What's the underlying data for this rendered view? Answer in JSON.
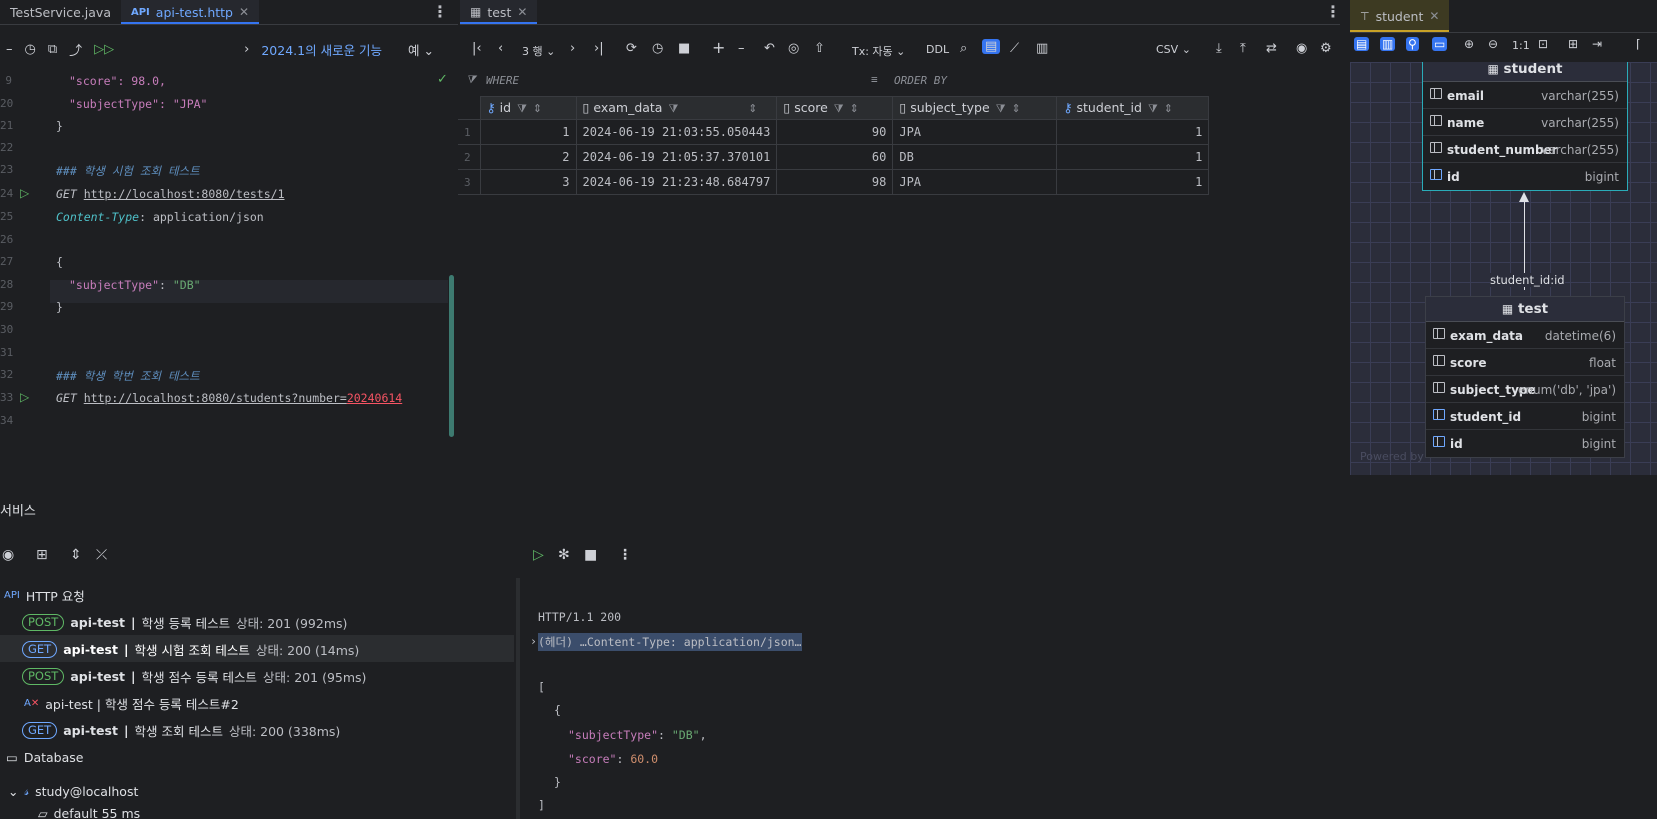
{
  "editor_tabs": [
    {
      "label": "TestService.java",
      "active": false
    },
    {
      "label": "api-test.http",
      "active": true,
      "icon": "API"
    }
  ],
  "grid_tabs": [
    {
      "label": "test",
      "active": true
    }
  ],
  "diagram_tabs": [
    {
      "label": "student",
      "active": true
    }
  ],
  "editor_toolbar": {
    "banner": "2024.1의 새로운 기능",
    "more": "예"
  },
  "editor": {
    "line_numbers": [
      "9",
      "20",
      "21",
      "22",
      "23",
      "24",
      "25",
      "26",
      "27",
      "28",
      "29",
      "30",
      "31",
      "32",
      "33",
      "34"
    ],
    "score_line": "\"score\": 98.0,",
    "subject_line": "\"subjectType\": \"JPA\"",
    "close_brace": "}",
    "comment1": "### 학생 시험 조회 테스트",
    "get1_method": "GET",
    "get1_url": "http://localhost:8080/tests/1",
    "ct_key": "Content-Type",
    "ct_val": ": application/json",
    "open_brace": "{",
    "body_key": "\"subjectType\"",
    "body_val": "\"DB\"",
    "close_brace2": "}",
    "comment2": "### 학생 학번 조회 테스트",
    "get2_method": "GET",
    "get2_url": "http://localhost:8080/students?number=",
    "get2_param": "20240614"
  },
  "grid_toolbar": {
    "rows": "3 행",
    "tx": "Tx: 자동",
    "ddl": "DDL",
    "format": "CSV"
  },
  "filter": {
    "where": "WHERE",
    "order_by": "ORDER BY"
  },
  "table": {
    "columns": [
      "id",
      "exam_data",
      "score",
      "subject_type",
      "student_id"
    ],
    "rows": [
      {
        "rn": "1",
        "id": "1",
        "exam_data": "2024-06-19 21:03:55.050443",
        "score": "90",
        "subject_type": "JPA",
        "student_id": "1"
      },
      {
        "rn": "2",
        "id": "2",
        "exam_data": "2024-06-19 21:05:37.370101",
        "score": "60",
        "subject_type": "DB",
        "student_id": "1"
      },
      {
        "rn": "3",
        "id": "3",
        "exam_data": "2024-06-19 21:23:48.684797",
        "score": "98",
        "subject_type": "JPA",
        "student_id": "1"
      }
    ]
  },
  "diagram": {
    "zoom": "1:1",
    "student": {
      "title": "student",
      "fields": [
        {
          "name": "email",
          "type": "varchar(255)"
        },
        {
          "name": "name",
          "type": "varchar(255)"
        },
        {
          "name": "student_number",
          "type": "varchar(255)"
        },
        {
          "name": "id",
          "type": "bigint"
        }
      ]
    },
    "relation_label": "student_id:id",
    "test": {
      "title": "test",
      "fields": [
        {
          "name": "exam_data",
          "type": "datetime(6)"
        },
        {
          "name": "score",
          "type": "float"
        },
        {
          "name": "subject_type",
          "type": "enum('db', 'jpa')"
        },
        {
          "name": "student_id",
          "type": "bigint"
        },
        {
          "name": "id",
          "type": "bigint"
        }
      ]
    },
    "watermark": "Powered by"
  },
  "services": {
    "title": "서비스",
    "http_root": "HTTP 요청",
    "requests": [
      {
        "method": "POST",
        "file": "api-test",
        "sep": "|",
        "name": "학생 등록 테스트",
        "status": "상태: 201 (992ms)"
      },
      {
        "method": "GET",
        "file": "api-test",
        "sep": "|",
        "name": "학생 시험 조회 테스트",
        "status": "상태: 200 (14ms)"
      },
      {
        "method": "POST",
        "file": "api-test",
        "sep": "|",
        "name": "학생 점수 등록 테스트",
        "status": "상태: 201 (95ms)"
      },
      {
        "label": "api-test | 학생 점수 등록 테스트#2"
      },
      {
        "method": "GET",
        "file": "api-test",
        "sep": "|",
        "name": "학생 조회 테스트",
        "status": "상태: 200 (338ms)"
      }
    ],
    "database": "Database",
    "connection": "study@localhost",
    "schema": "default 55 ms"
  },
  "response": {
    "status_line": "HTTP/1.1 200",
    "headers": "(헤더) …Content-Type: application/json…",
    "l1": "[",
    "l2": "{",
    "k1": "\"subjectType\"",
    "v1": "\"DB\"",
    "k2": "\"score\"",
    "v2": "60.0",
    "l5": "}",
    "l6": "]"
  }
}
